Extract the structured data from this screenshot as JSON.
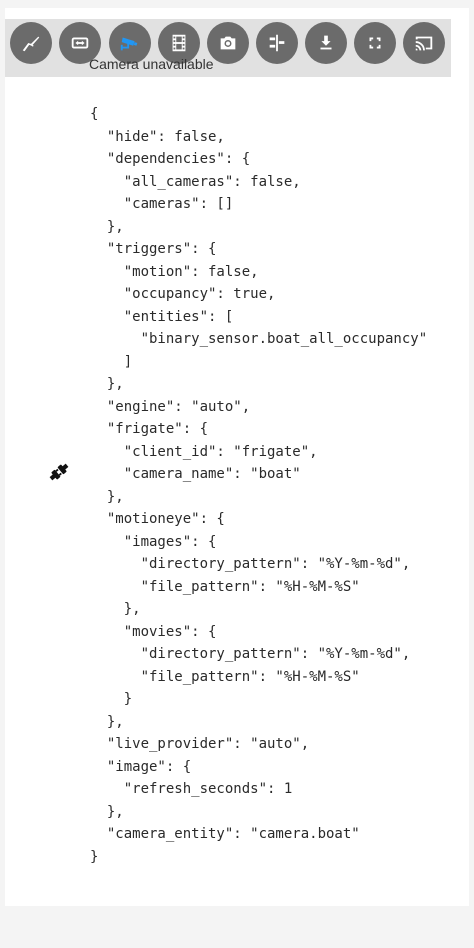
{
  "status": {
    "message": "Camera unavailable"
  },
  "toolbar": {
    "buttons": [
      {
        "icon": "frigate-logo-icon",
        "active": false
      },
      {
        "icon": "swap-horizontal-icon",
        "active": false
      },
      {
        "icon": "cctv-icon",
        "active": true
      },
      {
        "icon": "filmstrip-icon",
        "active": false
      },
      {
        "icon": "camera-icon",
        "active": false
      },
      {
        "icon": "timeline-icon",
        "active": false
      },
      {
        "icon": "download-icon",
        "active": false
      },
      {
        "icon": "fullscreen-icon",
        "active": false
      },
      {
        "icon": "cast-icon",
        "active": false
      }
    ],
    "colors": {
      "button_bg": "#6b6b6b",
      "icon": "#ffffff",
      "active_icon": "#2196f3",
      "bar_bg": "#e1e1e1"
    }
  },
  "error_icon": "plug-disconnected-icon",
  "config_text": "{\n  \"hide\": false,\n  \"dependencies\": {\n    \"all_cameras\": false,\n    \"cameras\": []\n  },\n  \"triggers\": {\n    \"motion\": false,\n    \"occupancy\": true,\n    \"entities\": [\n      \"binary_sensor.boat_all_occupancy\"\n    ]\n  },\n  \"engine\": \"auto\",\n  \"frigate\": {\n    \"client_id\": \"frigate\",\n    \"camera_name\": \"boat\"\n  },\n  \"motioneye\": {\n    \"images\": {\n      \"directory_pattern\": \"%Y-%m-%d\",\n      \"file_pattern\": \"%H-%M-%S\"\n    },\n    \"movies\": {\n      \"directory_pattern\": \"%Y-%m-%d\",\n      \"file_pattern\": \"%H-%M-%S\"\n    }\n  },\n  \"live_provider\": \"auto\",\n  \"image\": {\n    \"refresh_seconds\": 1\n  },\n  \"camera_entity\": \"camera.boat\"\n}"
}
